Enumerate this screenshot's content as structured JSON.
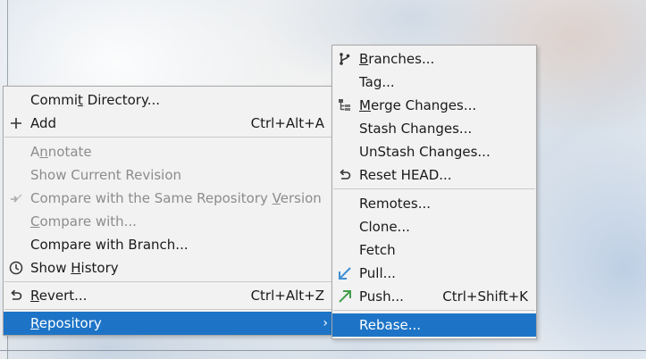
{
  "main_menu": {
    "items": {
      "commit_directory": {
        "pre": "Commi",
        "mnem": "t",
        "post": " Directory..."
      },
      "add": {
        "pre": "",
        "mnem": "",
        "post": "Add",
        "shortcut": "Ctrl+Alt+A"
      },
      "annotate": {
        "pre": "A",
        "mnem": "n",
        "post": "notate"
      },
      "show_current_revision": {
        "pre": "",
        "mnem": "",
        "post": "Show Current Revision"
      },
      "compare_same_repo": {
        "pre": "Compare with the Same Repository ",
        "mnem": "V",
        "post": "ersion"
      },
      "compare_with": {
        "pre": "",
        "mnem": "C",
        "post": "ompare with..."
      },
      "compare_with_branch": {
        "pre": "",
        "mnem": "",
        "post": "Compare with Branch..."
      },
      "show_history": {
        "pre": "Show ",
        "mnem": "H",
        "post": "istory"
      },
      "revert": {
        "pre": "",
        "mnem": "R",
        "post": "evert...",
        "shortcut": "Ctrl+Alt+Z"
      },
      "repository": {
        "pre": "",
        "mnem": "R",
        "post": "epository",
        "arrow": "›"
      }
    }
  },
  "sub_menu": {
    "items": {
      "branches": {
        "pre": "",
        "mnem": "B",
        "post": "ranches..."
      },
      "tag": {
        "pre": "",
        "mnem": "",
        "post": "Tag..."
      },
      "merge_changes": {
        "pre": "",
        "mnem": "M",
        "post": "erge Changes..."
      },
      "stash_changes": {
        "pre": "",
        "mnem": "",
        "post": "Stash Changes..."
      },
      "unstash_changes": {
        "pre": "",
        "mnem": "",
        "post": "UnStash Changes..."
      },
      "reset_head": {
        "pre": "",
        "mnem": "",
        "post": "Reset HEAD..."
      },
      "remotes": {
        "pre": "",
        "mnem": "",
        "post": "Remotes..."
      },
      "clone": {
        "pre": "",
        "mnem": "",
        "post": "Clone..."
      },
      "fetch": {
        "pre": "",
        "mnem": "",
        "post": "Fetch"
      },
      "pull": {
        "pre": "",
        "mnem": "",
        "post": "Pull..."
      },
      "push": {
        "pre": "",
        "mnem": "",
        "post": "Push...",
        "shortcut": "Ctrl+Shift+K"
      },
      "rebase": {
        "pre": "",
        "mnem": "",
        "post": "Rebase..."
      }
    }
  },
  "icons": {
    "add": "plus-icon",
    "compare_same_repo": "compare-arrows-icon",
    "show_history": "clock-icon",
    "revert": "undo-arrow-icon",
    "branches": "branch-icon",
    "merge_changes": "merge-tree-icon",
    "reset_head": "undo-arrow-icon",
    "pull": "pull-arrow-icon",
    "push": "push-arrow-icon"
  },
  "colors": {
    "selection": "#1d74c7",
    "pull_arrow": "#3d8fd6",
    "push_arrow": "#3f9e4a",
    "disabled_text": "#8c8c8c"
  }
}
